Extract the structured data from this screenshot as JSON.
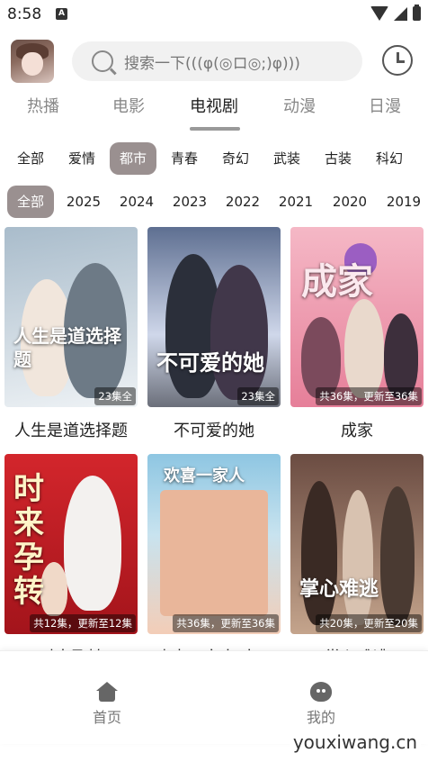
{
  "status_bar": {
    "time": "8:58",
    "sim_label": "A"
  },
  "search": {
    "placeholder": "搜索一下(((φ(◎ロ◎;)φ)))"
  },
  "main_tabs": [
    {
      "label": "热播",
      "active": false
    },
    {
      "label": "电影",
      "active": false
    },
    {
      "label": "电视剧",
      "active": true
    },
    {
      "label": "动漫",
      "active": false
    },
    {
      "label": "日漫",
      "active": false
    }
  ],
  "genres": [
    "全部",
    "爱情",
    "都市",
    "青春",
    "奇幻",
    "武装",
    "古装",
    "科幻"
  ],
  "genre_selected": "都市",
  "years": [
    "全部",
    "2025",
    "2024",
    "2023",
    "2022",
    "2021",
    "2020",
    "2019"
  ],
  "year_selected": "全部",
  "shows": [
    {
      "name": "人生是道选择题",
      "badge": "23集全",
      "poster_title": "人生是道选择题",
      "colors": [
        "#b7c9d6",
        "#e7eef3"
      ]
    },
    {
      "name": "不可爱的她",
      "badge": "23集全",
      "poster_title": "不可爱的她",
      "colors": [
        "#6e7f9c",
        "#d8dfee"
      ]
    },
    {
      "name": "成家",
      "badge": "共36集，更新至36集",
      "poster_title": "成家",
      "colors": [
        "#e58aa0",
        "#f6c7d1"
      ]
    },
    {
      "name": "时来孕转",
      "badge": "共12集，更新至12集",
      "poster_title": "时来孕转",
      "colors": [
        "#c01c24",
        "#e9474d"
      ]
    },
    {
      "name": "欢喜一家人·人...",
      "badge": "共36集，更新至36集",
      "poster_title": "欢喜一家人",
      "colors": [
        "#8dc3df",
        "#f4d5c4"
      ]
    },
    {
      "name": "掌心难逃",
      "badge": "共20集，更新至20集",
      "poster_title": "掌心难逃",
      "colors": [
        "#5a3f36",
        "#a98570"
      ]
    }
  ],
  "bottom_nav": [
    {
      "label": "首页",
      "icon": "home-icon"
    },
    {
      "label": "我的",
      "icon": "profile-icon"
    }
  ],
  "watermark": "youxiwang.cn"
}
